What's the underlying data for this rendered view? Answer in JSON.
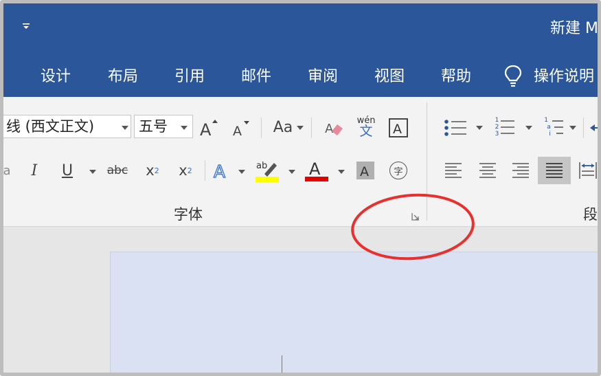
{
  "titlebar": {
    "doc_title": "新建 M"
  },
  "tabs": [
    {
      "label": "设计"
    },
    {
      "label": "布局"
    },
    {
      "label": "引用"
    },
    {
      "label": "邮件"
    },
    {
      "label": "审阅"
    },
    {
      "label": "视图"
    },
    {
      "label": "帮助"
    }
  ],
  "tell_me": {
    "label": "操作说明"
  },
  "font_group": {
    "font_name": "线 (西文正文)",
    "font_size": "五号",
    "change_case_label": "Aa",
    "phonetic_top": "wén",
    "phonetic_bottom": "文",
    "subscript_label": "x",
    "subscript_sub": "2",
    "superscript_label": "x",
    "superscript_sup": "2",
    "strike_label": "abc",
    "highlight_label": "ab",
    "enclose_label": "字",
    "label": "字体"
  },
  "paragraph_group": {
    "label": "段",
    "numbering_digits": [
      "1",
      "2",
      "3"
    ],
    "multilevel_marks": [
      "1",
      "a",
      "i"
    ]
  },
  "colors": {
    "ribbon_blue": "#2b579a",
    "highlight_yellow": "#ffff00",
    "font_red": "#e60000",
    "annotation_red": "#e8302e",
    "page_blue": "#d9e1f2"
  }
}
